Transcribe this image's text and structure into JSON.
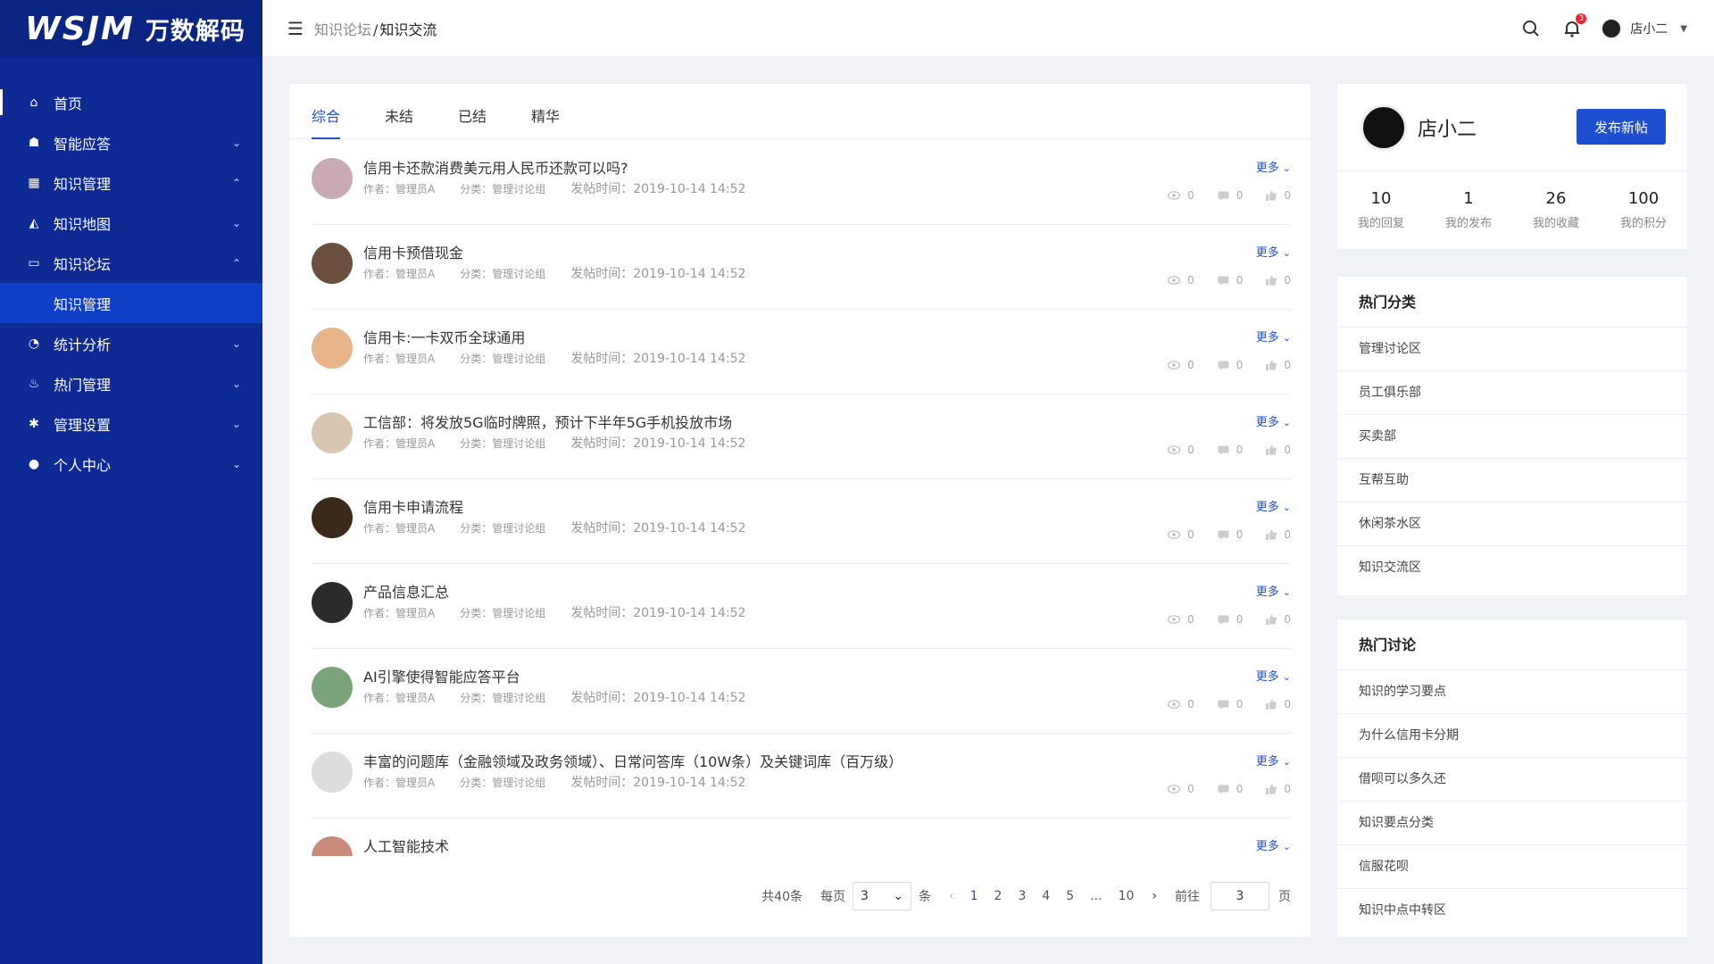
{
  "logo": {
    "mark": "WSJM",
    "name": "万数解码"
  },
  "sidebar": {
    "items": [
      {
        "label": "首页",
        "icon": "home-icon",
        "arrow": ""
      },
      {
        "label": "智能应答",
        "icon": "robot-icon",
        "arrow": "⌄"
      },
      {
        "label": "知识管理",
        "icon": "grid-icon",
        "arrow": "⌃"
      },
      {
        "label": "知识地图",
        "icon": "map-icon",
        "arrow": "⌄"
      },
      {
        "label": "知识论坛",
        "icon": "chat-icon",
        "arrow": "⌃"
      },
      {
        "label": "统计分析",
        "icon": "pie-chart-icon",
        "arrow": "⌄"
      },
      {
        "label": "热门管理",
        "icon": "flame-icon",
        "arrow": "⌄"
      },
      {
        "label": "管理设置",
        "icon": "gear-icon",
        "arrow": "⌄"
      },
      {
        "label": "个人中心",
        "icon": "user-icon",
        "arrow": "⌄"
      }
    ],
    "sub_item": "知识管理"
  },
  "topbar": {
    "breadcrumb_parent": "知识论坛",
    "breadcrumb_sep": "/",
    "breadcrumb_current": "知识交流",
    "notification_count": "3",
    "user_name": "店小二"
  },
  "tabs": [
    "综合",
    "未结",
    "已结",
    "精华"
  ],
  "posts": [
    {
      "title": "信用卡还款消费美元用人民币还款可以吗?",
      "author": "作者：管理员A",
      "category": "分类：管理讨论组",
      "time": "发帖时间：2019-10-14  14:52",
      "views": "0",
      "comments": "0",
      "likes": "0",
      "more": "更多"
    },
    {
      "title": "信用卡预借现金",
      "author": "作者：管理员A",
      "category": "分类：管理讨论组",
      "time": "发帖时间：2019-10-14  14:52",
      "views": "0",
      "comments": "0",
      "likes": "0",
      "more": "更多"
    },
    {
      "title": "信用卡:一卡双币全球通用",
      "author": "作者：管理员A",
      "category": "分类：管理讨论组",
      "time": "发帖时间：2019-10-14  14:52",
      "views": "0",
      "comments": "0",
      "likes": "0",
      "more": "更多"
    },
    {
      "title": "工信部：将发放5G临时牌照，预计下半年5G手机投放市场",
      "author": "作者：管理员A",
      "category": "分类：管理讨论组",
      "time": "发帖时间：2019-10-14  14:52",
      "views": "0",
      "comments": "0",
      "likes": "0",
      "more": "更多"
    },
    {
      "title": "信用卡申请流程",
      "author": "作者：管理员A",
      "category": "分类：管理讨论组",
      "time": "发帖时间：2019-10-14  14:52",
      "views": "0",
      "comments": "0",
      "likes": "0",
      "more": "更多"
    },
    {
      "title": "产品信息汇总",
      "author": "作者：管理员A",
      "category": "分类：管理讨论组",
      "time": "发帖时间：2019-10-14  14:52",
      "views": "0",
      "comments": "0",
      "likes": "0",
      "more": "更多"
    },
    {
      "title": "AI引擎使得智能应答平台",
      "author": "作者：管理员A",
      "category": "分类：管理讨论组",
      "time": "发帖时间：2019-10-14  14:52",
      "views": "0",
      "comments": "0",
      "likes": "0",
      "more": "更多"
    },
    {
      "title": "丰富的问题库（金融领域及政务领域）、日常问答库（10W条）及关键词库（百万级）",
      "author": "作者：管理员A",
      "category": "分类：管理讨论组",
      "time": "发帖时间：2019-10-14  14:52",
      "views": "0",
      "comments": "0",
      "likes": "0",
      "more": "更多"
    },
    {
      "title": "人工智能技术",
      "more": "更多"
    }
  ],
  "avatar_colors": [
    "#c9a9b5",
    "#6b4f3f",
    "#e8b48a",
    "#d9c6b0",
    "#3b2a1a",
    "#2b2b2b",
    "#7aa37a",
    "#dcdcdc",
    "#c98a7a"
  ],
  "pagination": {
    "total": "共40条",
    "per_page_label": "每页",
    "per_page_value": "3",
    "unit": "条",
    "pages": [
      "1",
      "2",
      "3",
      "4",
      "5",
      "...",
      "10"
    ],
    "current_page": "1",
    "goto_label": "前往",
    "goto_value": "3",
    "page_unit": "页"
  },
  "profile": {
    "name": "店小二",
    "new_post_label": "发布新帖",
    "stats": [
      {
        "value": "10",
        "label": "我的回复"
      },
      {
        "value": "1",
        "label": "我的发布"
      },
      {
        "value": "26",
        "label": "我的收藏"
      },
      {
        "value": "100",
        "label": "我的积分"
      }
    ]
  },
  "hot_categories": {
    "title": "热门分类",
    "items": [
      "管理讨论区",
      "员工俱乐部",
      "买卖部",
      "互帮互助",
      "休闲茶水区",
      "知识交流区"
    ]
  },
  "hot_discussions": {
    "title": "热门讨论",
    "items": [
      "知识的学习要点",
      "为什么信用卡分期",
      "借呗可以多久还",
      "知识要点分类",
      "信服花呗",
      "知识中点中转区"
    ]
  },
  "colors": {
    "sidebar_bg": "#0e2a94",
    "accent": "#1f4fd1",
    "active_sub_bg": "#0f3fc7",
    "badge": "#f5222d"
  }
}
